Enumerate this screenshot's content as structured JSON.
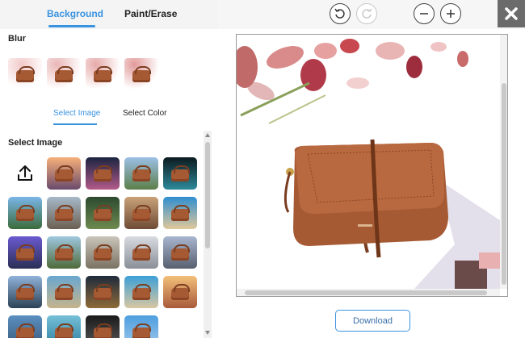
{
  "tabs": {
    "background": "Background",
    "paint_erase": "Paint/Erase"
  },
  "blur": {
    "title": "Blur",
    "thumb_count": 4
  },
  "subtabs": {
    "select_image": "Select Image",
    "select_color": "Select Color"
  },
  "select_image": {
    "title": "Select Image",
    "upload_icon": "upload-icon",
    "thumbnails": [
      {
        "name": "sunset-coast",
        "top": "#f6b07a",
        "bottom": "#6a4a6c"
      },
      {
        "name": "city-night",
        "top": "#1b2440",
        "bottom": "#b35a8a"
      },
      {
        "name": "mountains",
        "top": "#9bc0e6",
        "bottom": "#5c7f4a"
      },
      {
        "name": "dark-glow",
        "top": "#0b1a1e",
        "bottom": "#2e8a9a"
      },
      {
        "name": "tropical-sea",
        "top": "#7ab6e8",
        "bottom": "#3b6b3a"
      },
      {
        "name": "city-skyline",
        "top": "#a7b9c9",
        "bottom": "#6c5f52"
      },
      {
        "name": "forest-path",
        "top": "#2c4a2f",
        "bottom": "#6d8a4f"
      },
      {
        "name": "palace-arch",
        "top": "#c9a27a",
        "bottom": "#6e4b35"
      },
      {
        "name": "blue-beach",
        "top": "#2f8ed0",
        "bottom": "#e0c89a"
      },
      {
        "name": "purple-sky",
        "top": "#6a5ad0",
        "bottom": "#2b2f55"
      },
      {
        "name": "palm-shore",
        "top": "#9fc8e0",
        "bottom": "#4e6a3a"
      },
      {
        "name": "road-hills",
        "top": "#c9c4b9",
        "bottom": "#7a7263"
      },
      {
        "name": "cloudy-hill",
        "top": "#d8dbe0",
        "bottom": "#8a8f98"
      },
      {
        "name": "tower-city",
        "top": "#a8b6cf",
        "bottom": "#58606f"
      },
      {
        "name": "lake-dusk",
        "top": "#90b2da",
        "bottom": "#2c4256"
      },
      {
        "name": "wave-shore",
        "top": "#6aa7d1",
        "bottom": "#c5b48b"
      },
      {
        "name": "night-city",
        "top": "#1f2b3c",
        "bottom": "#8e6a38"
      },
      {
        "name": "palm-beach",
        "top": "#3c9fd8",
        "bottom": "#d8c7a1"
      },
      {
        "name": "sunset-glow",
        "top": "#f3c07a",
        "bottom": "#a85a3a"
      },
      {
        "name": "coast-cliff",
        "top": "#5a8fc0",
        "bottom": "#3a5a7a"
      },
      {
        "name": "lagoon",
        "top": "#76c0d8",
        "bottom": "#2d7ea0"
      },
      {
        "name": "tunnel",
        "top": "#1a1a1a",
        "bottom": "#5a5a5a"
      },
      {
        "name": "sky-blue",
        "top": "#4d9ee0",
        "bottom": "#a0c8ea"
      }
    ]
  },
  "toolbar": {
    "undo_icon": "undo-icon",
    "redo_icon": "redo-icon",
    "zoom_out_icon": "zoom-out-icon",
    "zoom_in_icon": "zoom-in-icon",
    "close_icon": "close-icon"
  },
  "download_label": "Download",
  "colors": {
    "accent": "#3a93e0",
    "bag": "#a65a34",
    "close_bg": "#6b6b6b"
  }
}
